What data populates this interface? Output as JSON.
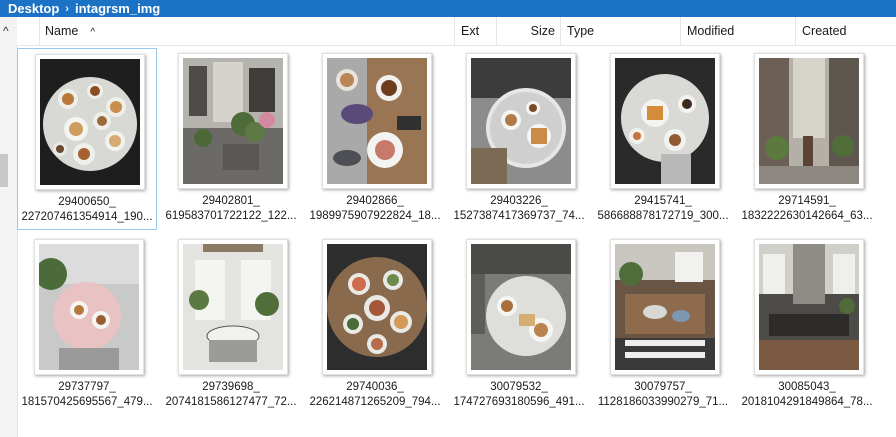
{
  "breadcrumb": {
    "items": [
      "Desktop",
      "intagrsm_img"
    ],
    "separator": "›"
  },
  "columns": {
    "name": "Name",
    "ext": "Ext",
    "size": "Size",
    "type": "Type",
    "modified": "Modified",
    "created": "Created"
  },
  "icons": {
    "sort": "sort-ascending-icon",
    "scroll_up": "chevron-up-icon"
  },
  "files": [
    {
      "line1": "29400650_",
      "line2": "227207461354914_190...",
      "selected": true
    },
    {
      "line1": "29402801_",
      "line2": "619583701722122_122...",
      "selected": false
    },
    {
      "line1": "29402866_",
      "line2": "1989975907922824_18...",
      "selected": false
    },
    {
      "line1": "29403226_",
      "line2": "1527387417369737_74...",
      "selected": false
    },
    {
      "line1": "29415741_",
      "line2": "586688878172719_300...",
      "selected": false
    },
    {
      "line1": "29714591_",
      "line2": "1832222630142664_63...",
      "selected": false
    },
    {
      "line1": "29737797_",
      "line2": "181570425695567_479...",
      "selected": false
    },
    {
      "line1": "29739698_",
      "line2": "2074181586127477_72...",
      "selected": false
    },
    {
      "line1": "29740036_",
      "line2": "226214871265209_794...",
      "selected": false
    },
    {
      "line1": "30079532_",
      "line2": "174727693180596_491...",
      "selected": false
    },
    {
      "line1": "30079757_",
      "line2": "1128186033990279_71...",
      "selected": false
    },
    {
      "line1": "30085043_",
      "line2": "2018104291849864_78...",
      "selected": false
    }
  ],
  "colors": {
    "breadcrumb_bg": "#1c72c4",
    "selection_border": "#99c9ef"
  }
}
